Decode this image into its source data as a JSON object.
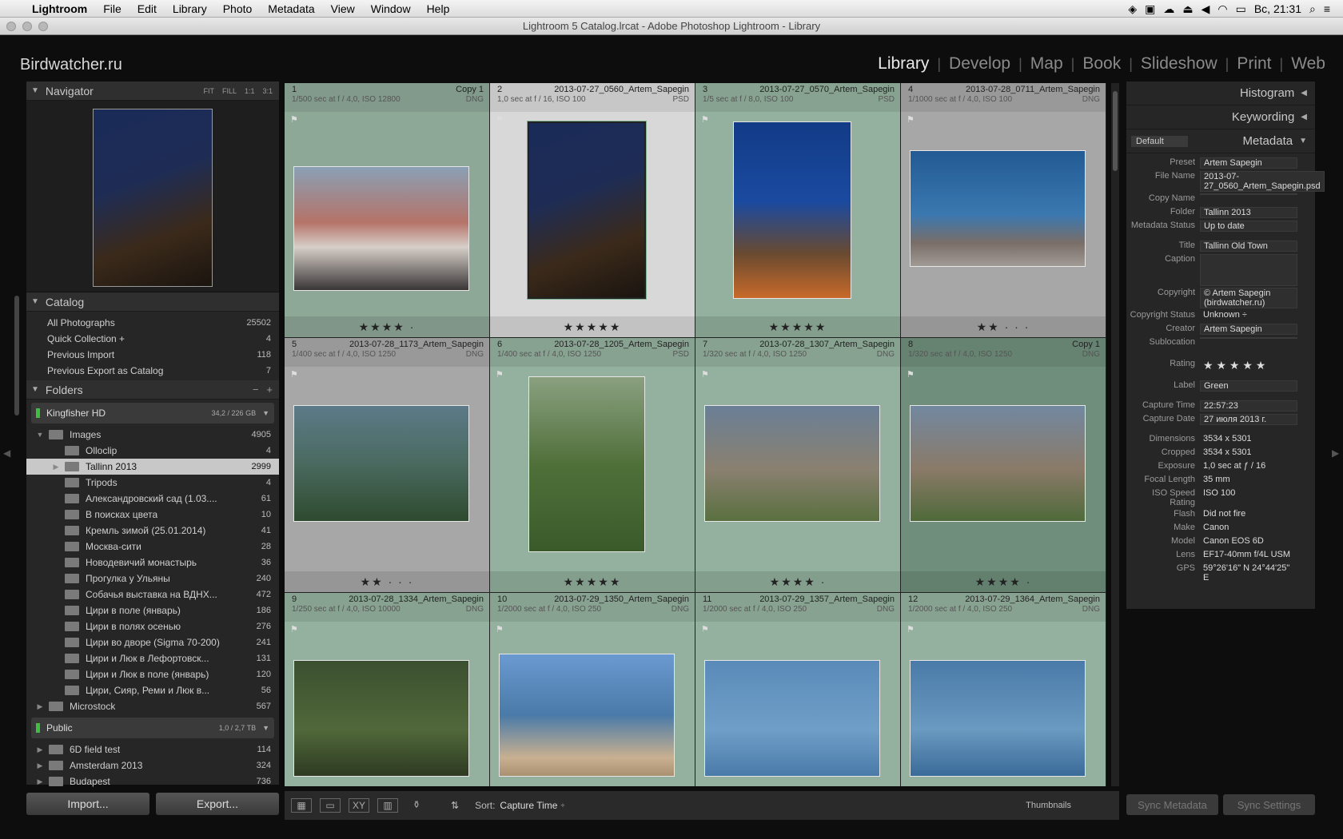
{
  "menubar": {
    "app": "Lightroom",
    "items": [
      "File",
      "Edit",
      "Library",
      "Photo",
      "Metadata",
      "View",
      "Window",
      "Help"
    ],
    "clock": "Вс, 21:31"
  },
  "window": {
    "title": "Lightroom 5 Catalog.lrcat - Adobe Photoshop Lightroom - Library"
  },
  "identity": {
    "brand": "Birdwatcher.ru"
  },
  "modules": [
    "Library",
    "Develop",
    "Map",
    "Book",
    "Slideshow",
    "Print",
    "Web"
  ],
  "navigator": {
    "title": "Navigator",
    "opts": [
      "FIT",
      "FILL",
      "1:1",
      "3:1"
    ]
  },
  "catalog": {
    "title": "Catalog",
    "items": [
      {
        "label": "All Photographs",
        "count": "25502"
      },
      {
        "label": "Quick Collection +",
        "count": "4"
      },
      {
        "label": "Previous Import",
        "count": "118"
      },
      {
        "label": "Previous Export as Catalog",
        "count": "7"
      }
    ]
  },
  "folders": {
    "title": "Folders",
    "volumes": [
      {
        "name": "Kingfisher HD",
        "size": "34,2 / 226 GB"
      },
      {
        "name": "Public",
        "size": "1,0 / 2,7 TB"
      }
    ],
    "images": {
      "label": "Images",
      "count": "4905"
    },
    "items": [
      {
        "label": "Olloclip",
        "count": "4"
      },
      {
        "label": "Tallinn 2013",
        "count": "2999"
      },
      {
        "label": "Tripods",
        "count": "4"
      },
      {
        "label": "Александровский сад (1.03....",
        "count": "61"
      },
      {
        "label": "В поисках цвета",
        "count": "10"
      },
      {
        "label": "Кремль зимой (25.01.2014)",
        "count": "41"
      },
      {
        "label": "Москва-сити",
        "count": "28"
      },
      {
        "label": "Новодевичий монастырь",
        "count": "36"
      },
      {
        "label": "Прогулка у Ульяны",
        "count": "240"
      },
      {
        "label": "Собачья выставка на ВДНХ...",
        "count": "472"
      },
      {
        "label": "Цири в поле (январь)",
        "count": "186"
      },
      {
        "label": "Цири в полях осенью",
        "count": "276"
      },
      {
        "label": "Цири во дворе (Sigma 70-200)",
        "count": "241"
      },
      {
        "label": "Цири и Люк в Лефортовск...",
        "count": "131"
      },
      {
        "label": "Цири и Люк в поле (январь)",
        "count": "120"
      },
      {
        "label": "Цири, Сияр, Реми и Люк в...",
        "count": "56"
      }
    ],
    "microstock": {
      "label": "Microstock",
      "count": "567"
    },
    "public_items": [
      {
        "label": "6D field test",
        "count": "114"
      },
      {
        "label": "Amsterdam 2013",
        "count": "324"
      },
      {
        "label": "Budapest",
        "count": "736"
      }
    ]
  },
  "left_buttons": {
    "import": "Import...",
    "export": "Export..."
  },
  "grid": [
    {
      "idx": "1",
      "name": "Copy 1",
      "exp": "1/500 sec at f / 4,0, ISO 12800",
      "fmt": "DNG",
      "stars": "★★★★ ·"
    },
    {
      "idx": "2",
      "name": "2013-07-27_0560_Artem_Sapegin",
      "exp": "1,0 sec at f / 16, ISO 100",
      "fmt": "PSD",
      "stars": "★★★★★"
    },
    {
      "idx": "3",
      "name": "2013-07-27_0570_Artem_Sapegin",
      "exp": "1/5 sec at f / 8,0, ISO 100",
      "fmt": "PSD",
      "stars": "★★★★★"
    },
    {
      "idx": "4",
      "name": "2013-07-28_0711_Artem_Sapegin",
      "exp": "1/1000 sec at f / 4,0, ISO 100",
      "fmt": "DNG",
      "stars": "★★ · · ·"
    },
    {
      "idx": "5",
      "name": "2013-07-28_1173_Artem_Sapegin",
      "exp": "1/400 sec at f / 4,0, ISO 1250",
      "fmt": "DNG",
      "stars": "★★ · · ·"
    },
    {
      "idx": "6",
      "name": "2013-07-28_1205_Artem_Sapegin",
      "exp": "1/400 sec at f / 4,0, ISO 1250",
      "fmt": "PSD",
      "stars": "★★★★★"
    },
    {
      "idx": "7",
      "name": "2013-07-28_1307_Artem_Sapegin",
      "exp": "1/320 sec at f / 4,0, ISO 1250",
      "fmt": "DNG",
      "stars": "★★★★ ·"
    },
    {
      "idx": "8",
      "name": "Copy 1",
      "exp": "1/320 sec at f / 4,0, ISO 1250",
      "fmt": "DNG",
      "stars": "★★★★ ·"
    },
    {
      "idx": "9",
      "name": "2013-07-28_1334_Artem_Sapegin",
      "exp": "1/250 sec at f / 4,0, ISO 10000",
      "fmt": "DNG",
      "stars": ""
    },
    {
      "idx": "10",
      "name": "2013-07-29_1350_Artem_Sapegin",
      "exp": "1/2000 sec at f / 4,0, ISO 250",
      "fmt": "DNG",
      "stars": ""
    },
    {
      "idx": "11",
      "name": "2013-07-29_1357_Artem_Sapegin",
      "exp": "1/2000 sec at f / 4,0, ISO 250",
      "fmt": "DNG",
      "stars": ""
    },
    {
      "idx": "12",
      "name": "2013-07-29_1364_Artem_Sapegin",
      "exp": "1/2000 sec at f / 4,0, ISO 250",
      "fmt": "DNG",
      "stars": ""
    }
  ],
  "toolbar": {
    "sort_label": "Sort:",
    "sort_value": "Capture Time",
    "thumbs_label": "Thumbnails"
  },
  "right": {
    "histogram": "Histogram",
    "keywording": "Keywording",
    "metadata": "Metadata",
    "preset_select": "Default",
    "fields": [
      {
        "k": "Preset",
        "v": "Artem Sapegin"
      },
      {
        "k": "File Name",
        "v": "2013-07-27_0560_Artem_Sapegin.psd"
      },
      {
        "k": "Copy Name",
        "v": ""
      },
      {
        "k": "Folder",
        "v": "Tallinn 2013"
      },
      {
        "k": "Metadata Status",
        "v": "Up to date"
      },
      {
        "k": "Title",
        "v": "Tallinn Old Town"
      },
      {
        "k": "Caption",
        "v": ""
      },
      {
        "k": "Copyright",
        "v": "© Artem Sapegin (birdwatcher.ru)"
      },
      {
        "k": "Copyright Status",
        "v": "Unknown ÷"
      },
      {
        "k": "Creator",
        "v": "Artem Sapegin"
      },
      {
        "k": "Sublocation",
        "v": ""
      },
      {
        "k": "Rating",
        "v": "★ ★ ★ ★ ★"
      },
      {
        "k": "Label",
        "v": "Green"
      },
      {
        "k": "Capture Time",
        "v": "22:57:23"
      },
      {
        "k": "Capture Date",
        "v": "27 июля 2013 г."
      },
      {
        "k": "Dimensions",
        "v": "3534 x 5301"
      },
      {
        "k": "Cropped",
        "v": "3534 x 5301"
      },
      {
        "k": "Exposure",
        "v": "1,0 sec at ƒ / 16"
      },
      {
        "k": "Focal Length",
        "v": "35 mm"
      },
      {
        "k": "ISO Speed Rating",
        "v": "ISO 100"
      },
      {
        "k": "Flash",
        "v": "Did not fire"
      },
      {
        "k": "Make",
        "v": "Canon"
      },
      {
        "k": "Model",
        "v": "Canon EOS 6D"
      },
      {
        "k": "Lens",
        "v": "EF17-40mm f/4L USM"
      },
      {
        "k": "GPS",
        "v": "59°26'16\" N 24°44'25\" E"
      }
    ]
  },
  "right_buttons": {
    "sync_metadata": "Sync Metadata",
    "sync_settings": "Sync Settings"
  }
}
